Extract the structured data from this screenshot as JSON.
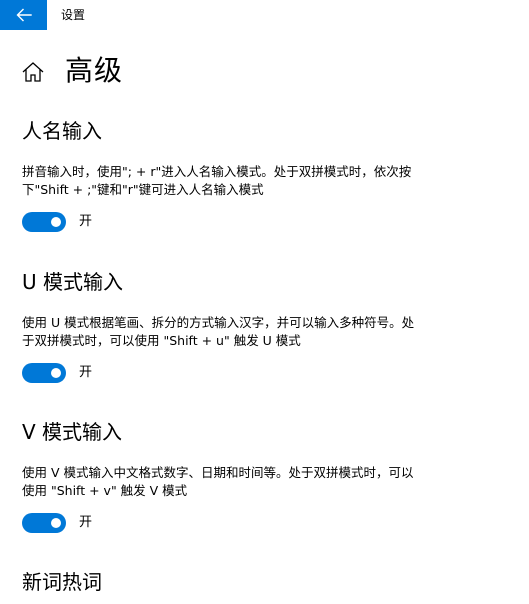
{
  "window": {
    "title": "设置",
    "back_icon": "arrow-left-icon",
    "accent_color": "#0078d7"
  },
  "header": {
    "home_icon": "home-icon",
    "title": "高级"
  },
  "sections": [
    {
      "title": "人名输入",
      "description_line1": "拼音输入时，使用\"; + r\"进入人名输入模式。处于双拼模式时，依次按",
      "description_line2": "下\"Shift + ;\"键和\"r\"键可进入人名输入模式",
      "toggle_on": true,
      "toggle_label": "开"
    },
    {
      "title": "U 模式输入",
      "description_line1": "使用 U 模式根据笔画、拆分的方式输入汉字，并可以输入多种符号。处",
      "description_line2": "于双拼模式时，可以使用 \"Shift + u\" 触发 U 模式",
      "toggle_on": true,
      "toggle_label": "开"
    },
    {
      "title": "V 模式输入",
      "description_line1": "使用 V 模式输入中文格式数字、日期和时间等。处于双拼模式时，可以",
      "description_line2": "使用 \"Shift + v\" 触发 V 模式",
      "toggle_on": true,
      "toggle_label": "开"
    },
    {
      "title": "新词热词"
    }
  ]
}
